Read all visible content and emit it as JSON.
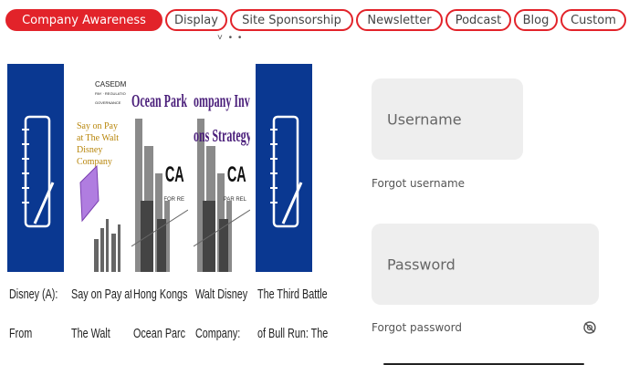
{
  "tabs": [
    {
      "label": "Company Awareness",
      "active": true
    },
    {
      "label": "Display",
      "active": false
    },
    {
      "label": "Site Sponsorship",
      "active": false
    },
    {
      "label": "Newsletter",
      "active": false
    },
    {
      "label": "Podcast",
      "active": false
    },
    {
      "label": "Blog",
      "active": false
    },
    {
      "label": "Custom",
      "active": false
    }
  ],
  "scroll_indicator": "˅ • •",
  "books": [
    {
      "title_line1": "Disney (A):",
      "title_line2": "From"
    },
    {
      "title_line1": "Say on Pay at",
      "title_line2": "The Walt",
      "cover_publisher": "CASEDM.COM",
      "cover_publisher_sub": "PAY · REGULATION · GOVERNANCE",
      "cover_title": "Say on Pay at The Walt Disney Company"
    },
    {
      "title_line1": "Hong Kongs",
      "title_line2": "Ocean Parc",
      "cover_title": "Ocean Park Tal",
      "cover_mark": "CA",
      "cover_small": "FOR RE"
    },
    {
      "title_line1": "Walt Disney",
      "title_line2": "Company:",
      "cover_title": "ompany Invest",
      "cover_title2": "ons Strategy",
      "cover_mark": "CA",
      "cover_small": "PAR REL"
    },
    {
      "title_line1": "The Third Battle",
      "title_line2": "of Bull Run: The"
    }
  ],
  "login": {
    "username_placeholder": "Username",
    "forgot_username": "Forgot username",
    "password_placeholder": "Password",
    "forgot_password": "Forgot password"
  },
  "colors": {
    "accent": "#e2232a",
    "book_blue": "#0a3891",
    "field_bg": "#eeeeee"
  }
}
